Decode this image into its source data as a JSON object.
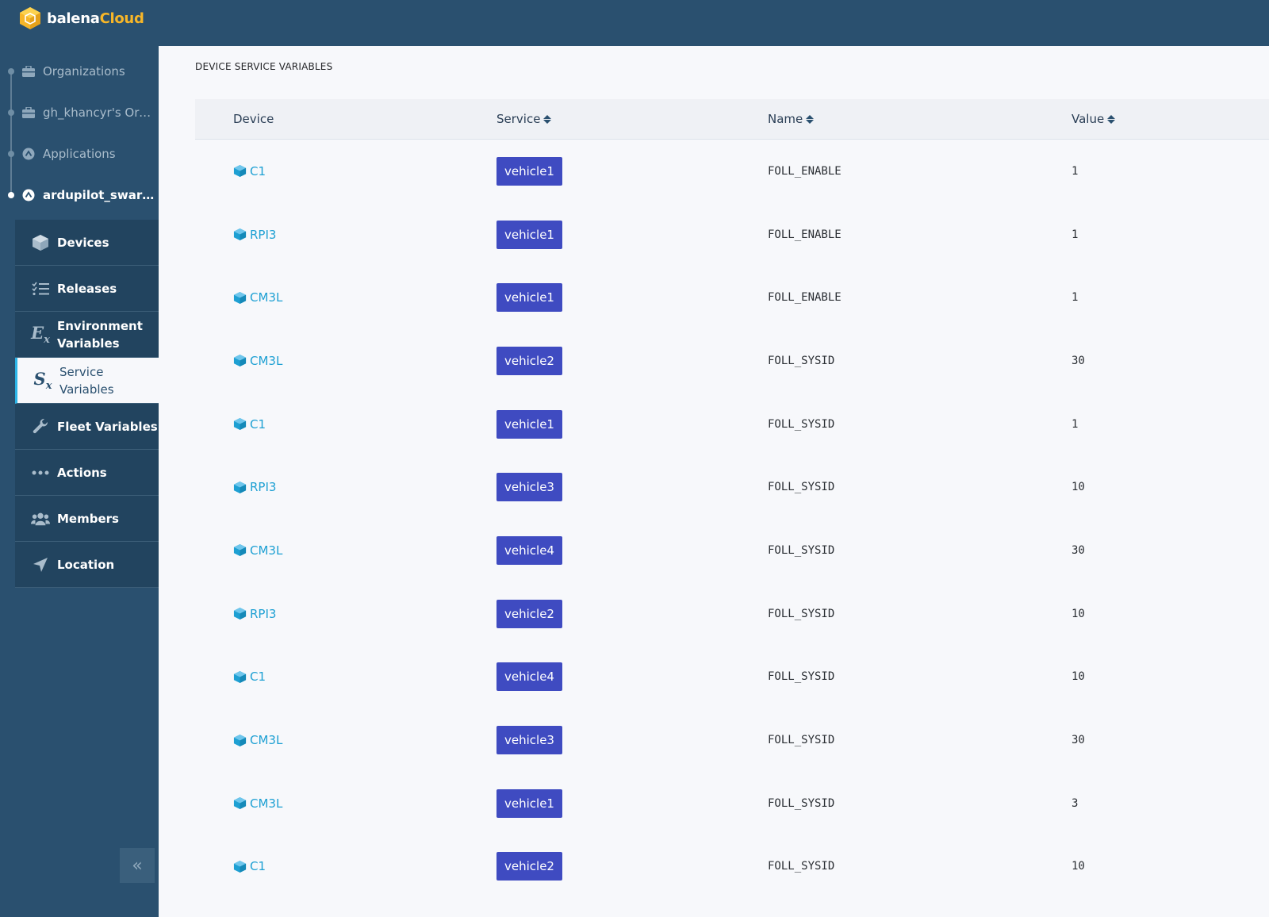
{
  "brand": {
    "part1": "balena",
    "part2": "Cloud"
  },
  "breadcrumbs": [
    {
      "label": "Organizations",
      "icon": "briefcase-icon",
      "active": false
    },
    {
      "label": "gh_khancyr's Org...",
      "icon": "briefcase-icon",
      "active": false
    },
    {
      "label": "Applications",
      "icon": "fleet-icon",
      "active": false
    },
    {
      "label": "ardupilot_swarm...",
      "icon": "fleet-icon",
      "active": true
    }
  ],
  "nav": [
    {
      "label": "Devices",
      "icon": "cube-icon"
    },
    {
      "label": "Releases",
      "icon": "list-check-icon"
    },
    {
      "label_line1": "Environment",
      "label_line2": "Variables",
      "icon": "env-var-icon",
      "icon_text": "E",
      "icon_sub": "x"
    },
    {
      "label_line1": "Service",
      "label_line2": "Variables",
      "icon": "service-var-icon",
      "icon_text": "S",
      "icon_sub": "x",
      "selected": true
    },
    {
      "label": "Fleet Variables",
      "icon": "wrench-icon"
    },
    {
      "label": "Actions",
      "icon": "ellipsis-icon"
    },
    {
      "label": "Members",
      "icon": "users-icon"
    },
    {
      "label": "Location",
      "icon": "location-arrow-icon"
    }
  ],
  "collapse": {
    "glyph": "«"
  },
  "page": {
    "title": "DEVICE SERVICE VARIABLES"
  },
  "table": {
    "columns": [
      "Device",
      "Service",
      "Name",
      "Value"
    ],
    "rows": [
      {
        "device": "C1",
        "service": "vehicle1",
        "name": "FOLL_ENABLE",
        "value": "1"
      },
      {
        "device": "RPI3",
        "service": "vehicle1",
        "name": "FOLL_ENABLE",
        "value": "1"
      },
      {
        "device": "CM3L",
        "service": "vehicle1",
        "name": "FOLL_ENABLE",
        "value": "1"
      },
      {
        "device": "CM3L",
        "service": "vehicle2",
        "name": "FOLL_SYSID",
        "value": "30"
      },
      {
        "device": "C1",
        "service": "vehicle1",
        "name": "FOLL_SYSID",
        "value": "1"
      },
      {
        "device": "RPI3",
        "service": "vehicle3",
        "name": "FOLL_SYSID",
        "value": "10"
      },
      {
        "device": "CM3L",
        "service": "vehicle4",
        "name": "FOLL_SYSID",
        "value": "30"
      },
      {
        "device": "RPI3",
        "service": "vehicle2",
        "name": "FOLL_SYSID",
        "value": "10"
      },
      {
        "device": "C1",
        "service": "vehicle4",
        "name": "FOLL_SYSID",
        "value": "10"
      },
      {
        "device": "CM3L",
        "service": "vehicle3",
        "name": "FOLL_SYSID",
        "value": "30"
      },
      {
        "device": "CM3L",
        "service": "vehicle1",
        "name": "FOLL_SYSID",
        "value": "3"
      },
      {
        "device": "C1",
        "service": "vehicle2",
        "name": "FOLL_SYSID",
        "value": "10"
      }
    ]
  },
  "colors": {
    "sidebar": "#2a506f",
    "nav_item": "#22445f",
    "accent": "#2bb5e8",
    "badge": "#3f4bc1",
    "device_link": "#1ea0d3",
    "logo_yellow": "#f7b628"
  }
}
